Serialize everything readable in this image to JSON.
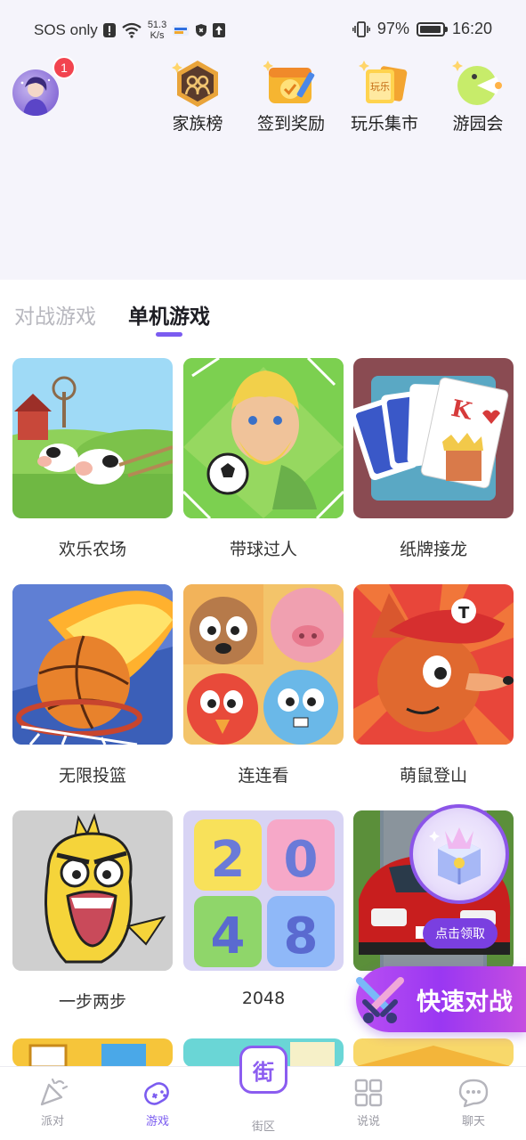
{
  "status_bar": {
    "carrier": "SOS only",
    "net_speed_value": "51.3",
    "net_speed_unit": "K/s",
    "battery": "97%",
    "time": "16:20",
    "battery_level": 0.97
  },
  "header": {
    "avatar_badge": "1",
    "entries": [
      {
        "label": "家族榜",
        "icon": "family-rank-icon"
      },
      {
        "label": "签到奖励",
        "icon": "checkin-reward-icon"
      },
      {
        "label": "玩乐集市",
        "icon": "fun-market-icon"
      },
      {
        "label": "游园会",
        "icon": "carnival-icon"
      }
    ],
    "market_tile_text": "玩乐"
  },
  "tabs": [
    {
      "label": "对战游戏",
      "active": false
    },
    {
      "label": "单机游戏",
      "active": true
    }
  ],
  "games": [
    {
      "name": "欢乐农场"
    },
    {
      "name": "带球过人"
    },
    {
      "name": "纸牌接龙"
    },
    {
      "name": "无限投篮"
    },
    {
      "name": "连连看"
    },
    {
      "name": "萌鼠登山"
    },
    {
      "name": "一步两步"
    },
    {
      "name": "2048"
    },
    {
      "name": ""
    }
  ],
  "game_2048_digits": [
    "2",
    "0",
    "4",
    "8"
  ],
  "solitaire_card": "K",
  "floating": {
    "claim_button": "点击领取",
    "quick_battle": "快速对战"
  },
  "bottom_nav": [
    {
      "label": "派对",
      "icon": "party-icon"
    },
    {
      "label": "游戏",
      "icon": "gamepad-icon",
      "active": true
    },
    {
      "label": "街区",
      "icon": "street-icon"
    },
    {
      "label": "说说",
      "icon": "posts-grid-icon"
    },
    {
      "label": "聊天",
      "icon": "chat-icon"
    }
  ],
  "street_icon_char": "街",
  "colors": {
    "accent": "#7b5cf0",
    "badge": "#f2444f",
    "quick_battle": "#9a37f2"
  }
}
